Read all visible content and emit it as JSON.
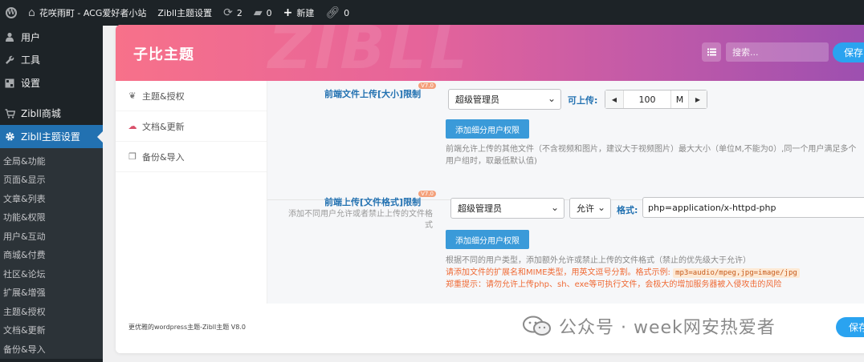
{
  "adminbar": {
    "site_name": "花咲雨町 - ACG爱好者小站",
    "theme_settings": "Zibll主题设置",
    "updates_count": "2",
    "comments_count": "0",
    "new_label": "新建",
    "links_count": "0"
  },
  "sidebar": {
    "items": [
      {
        "label": "用户",
        "icon": "user-icon"
      },
      {
        "label": "工具",
        "icon": "wrench-icon"
      },
      {
        "label": "设置",
        "icon": "settings-icon"
      },
      {
        "label": "Zibll商城",
        "icon": "cart-icon"
      },
      {
        "label": "Zibll主题设置",
        "icon": "gear-icon"
      }
    ],
    "submenu": [
      "全局&功能",
      "页面&显示",
      "文章&列表",
      "功能&权限",
      "用户&互动",
      "商城&付费",
      "社区&论坛",
      "扩展&增强",
      "主题&授权",
      "文档&更新",
      "备份&导入"
    ]
  },
  "banner": {
    "title": "子比主题",
    "deco": "ZIBLL",
    "search_placeholder": "搜索...",
    "save_label": "保存"
  },
  "tabs": [
    {
      "label": "主题&授权",
      "icon": "leaf-icon"
    },
    {
      "label": "文档&更新",
      "icon": "cloud-icon"
    },
    {
      "label": "备份&导入",
      "icon": "copy-icon"
    }
  ],
  "field1": {
    "title": "前端文件上传[大小]限制",
    "badge": "V7.0",
    "select_value": "超级管理员",
    "upload_label": "可上传:",
    "size_value": "100",
    "size_unit": "M",
    "add_button": "添加细分用户权限",
    "help": "前端允许上传的其他文件（不含视频和图片，建议大于视频图片）最大大小（单位M,不能为0）,同一个用户满足多个用户组时，取最低默认值)"
  },
  "field2": {
    "title": "前端上传[文件格式]限制",
    "badge": "V7.0",
    "desc": "添加不同用户允许或者禁止上传的文件格式",
    "select_value": "超级管理员",
    "allow_value": "允许",
    "format_label": "格式:",
    "format_value": "php=application/x-httpd-php",
    "add_button": "添加细分用户权限",
    "help1": "根据不同的用户类型，添加额外允许或禁止上传的文件格式（禁止的优先级大于允许）",
    "help2": "请添加文件的扩展名和MIME类型，用英文逗号分割。格式示例:",
    "help2_code": "mp3=audio/mpeg,jpg=image/jpg",
    "help3": "郑重提示：请勿允许上传php、sh、exe等可执行文件，会极大的增加服务器被入侵攻击的风险"
  },
  "footer": {
    "text": "更优雅的wordpress主题-Zibll主题 V8.0",
    "save_label": "保存"
  },
  "watermark": {
    "text": "公众号 · week网安热爱者"
  }
}
